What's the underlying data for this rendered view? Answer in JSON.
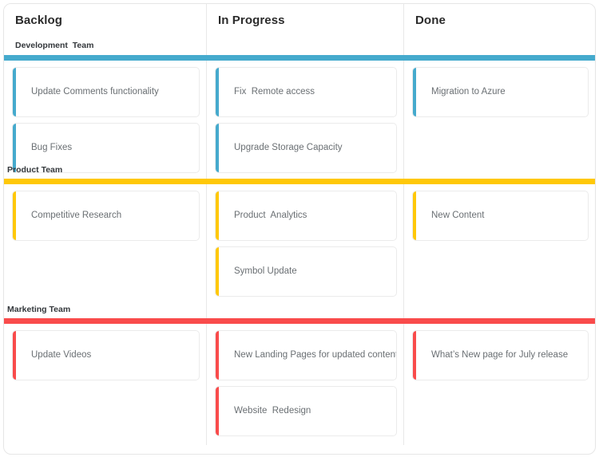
{
  "board": {
    "columns": [
      {
        "title": "Backlog"
      },
      {
        "title": "In Progress"
      },
      {
        "title": "Done"
      }
    ],
    "lanes": [
      {
        "label": "Development  Team",
        "color": "#45AACD",
        "cards": {
          "backlog": [
            {
              "text": "Update Comments functionality"
            },
            {
              "text": "Bug Fixes"
            }
          ],
          "in_progress": [
            {
              "text": "Fix  Remote access"
            },
            {
              "text": "Upgrade Storage Capacity"
            }
          ],
          "done": [
            {
              "text": "Migration to Azure"
            }
          ]
        }
      },
      {
        "label": "Product Team",
        "color": "#FFC808",
        "cards": {
          "backlog": [
            {
              "text": "Competitive Research"
            }
          ],
          "in_progress": [
            {
              "text": "Product  Analytics"
            },
            {
              "text": "Symbol Update"
            }
          ],
          "done": [
            {
              "text": "New Content"
            }
          ]
        }
      },
      {
        "label": "Marketing Team",
        "color": "#F94B4B",
        "cards": {
          "backlog": [
            {
              "text": "Update Videos"
            }
          ],
          "in_progress": [
            {
              "text": "New Landing Pages for updated content"
            },
            {
              "text": "Website  Redesign"
            }
          ],
          "done": [
            {
              "text": "What’s New page for July release"
            }
          ]
        }
      }
    ]
  }
}
